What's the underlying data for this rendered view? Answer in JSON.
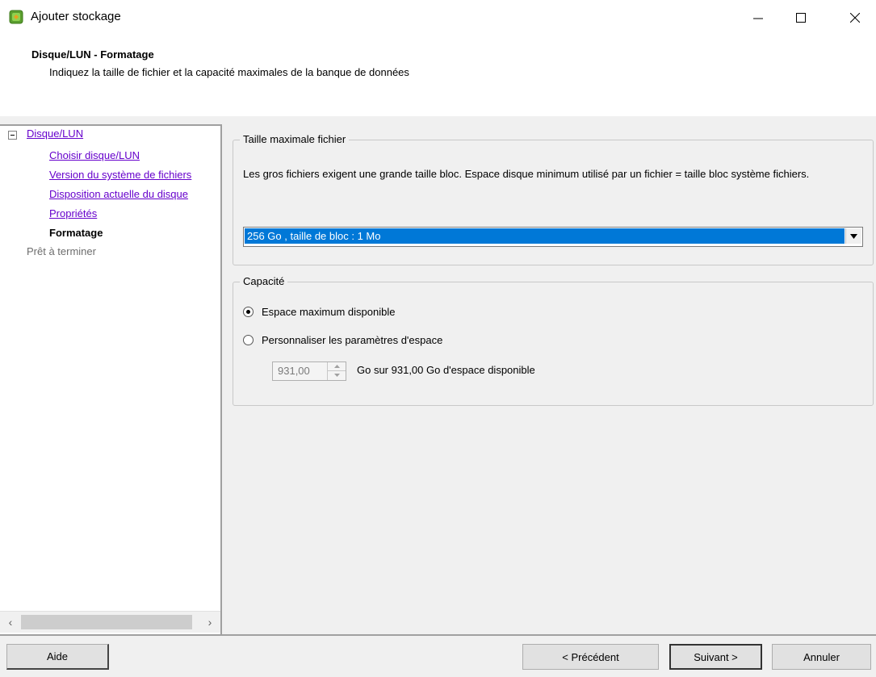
{
  "window": {
    "title": "Ajouter stockage",
    "icon": "storage-wizard-icon"
  },
  "header": {
    "title": "Disque/LUN - Formatage",
    "subtitle": "Indiquez la taille de fichier et la capacité maximales de la banque de données"
  },
  "nav": {
    "items": [
      {
        "label": "Disque/LUN",
        "state": "link"
      },
      {
        "label": "Choisir disque/LUN",
        "state": "link"
      },
      {
        "label": "Version du système de fichiers",
        "state": "link"
      },
      {
        "label": "Disposition actuelle du disque",
        "state": "link"
      },
      {
        "label": "Propriétés",
        "state": "link"
      },
      {
        "label": "Formatage",
        "state": "current"
      },
      {
        "label": "Prêt à terminer",
        "state": "disabled"
      }
    ]
  },
  "file_size": {
    "group_label": "Taille maximale fichier",
    "description": "Les gros fichiers exigent une grande taille bloc. Espace disque minimum utilisé par un fichier = taille bloc système fichiers.",
    "selected": "256 Go  ,  taille de bloc : 1 Mo"
  },
  "capacity": {
    "group_label": "Capacité",
    "option_max": "Espace maximum disponible",
    "option_custom": "Personnaliser les paramètres d'espace",
    "selected_option": "max",
    "value": "931,00",
    "suffix": "Go sur 931,00 Go d'espace disponible"
  },
  "buttons": {
    "help": "Aide",
    "back": "< Précédent",
    "next": "Suivant >",
    "cancel": "Annuler"
  },
  "colors": {
    "link": "#6600cc",
    "selection": "#0078d7",
    "disabled_text": "#6d6d6d"
  }
}
